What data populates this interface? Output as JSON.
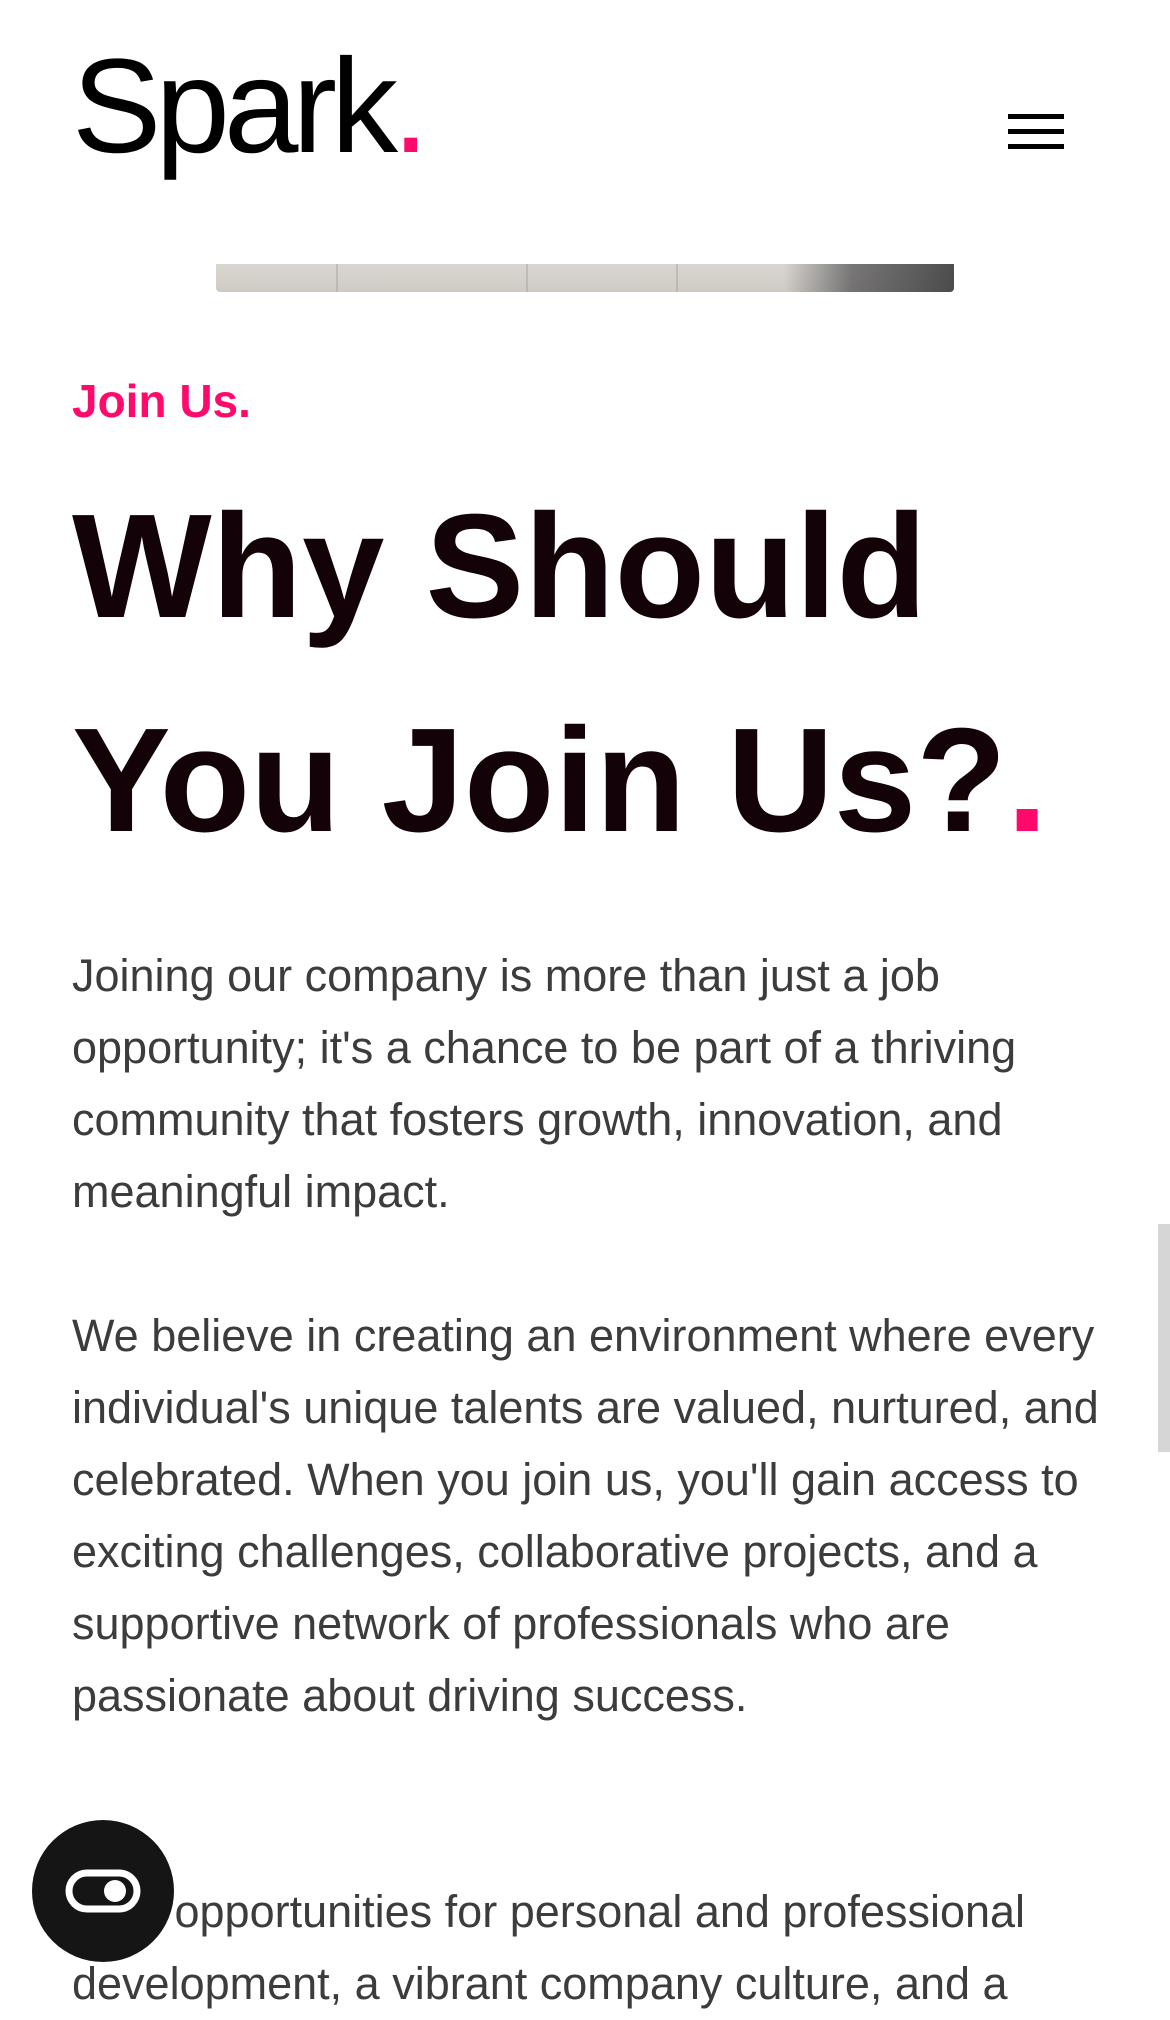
{
  "header": {
    "logo_text": "Spark",
    "logo_dot": ".",
    "menu_icon": "hamburger-menu-icon"
  },
  "hero_image": {
    "description_icon": "photo-strip"
  },
  "section": {
    "eyebrow": "Join Us.",
    "headline_line1": "Why Should",
    "headline_line2": "You Join Us?",
    "headline_dot": ".",
    "paragraphs": [
      "Joining our company is more than just a job opportunity; it's a chance to be part of a thriving community that fosters growth, innovation, and meaningful impact.",
      "We believe in creating an environment where every individual's unique talents are valued, nurtured, and celebrated. When you join us, you'll gain access to exciting challenges, collaborative projects, and a supportive network of professionals who are passionate about driving success.",
      "With opportunities for personal and professional development, a vibrant company culture, and a"
    ]
  },
  "accessibility_widget": {
    "icon": "accessibility-toggle-icon"
  },
  "colors": {
    "accent": "#ff0a6c",
    "heading": "#130207",
    "body": "#3c3c3c",
    "widget_bg": "#151515"
  }
}
